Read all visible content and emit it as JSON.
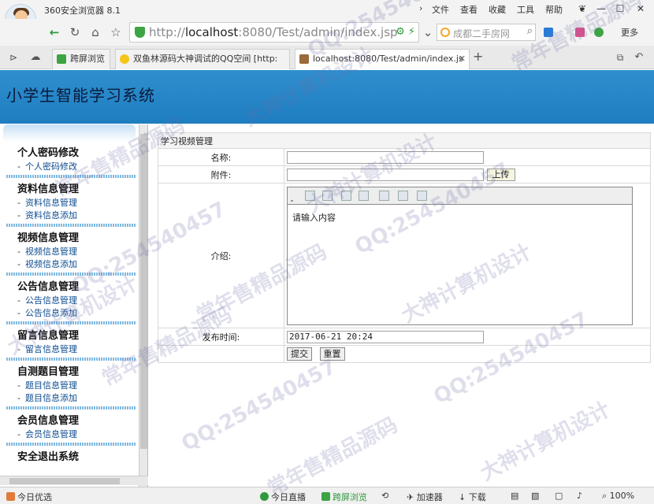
{
  "browser": {
    "app_title": "360安全浏览器 8.1",
    "top_menu": [
      "文件",
      "查看",
      "收藏",
      "工具",
      "帮助"
    ],
    "url_host": "http://",
    "url_main": "localhost",
    "url_rest": ":8080/Test/admin/index.jsp",
    "search_placeholder": "成都二手房网",
    "more_label": "更多",
    "tabs": [
      {
        "label": "跨屏浏览",
        "color": "#3da443"
      },
      {
        "label": "双鱼林源码大神调试的QQ空间 [http:",
        "color": "#f5c518"
      },
      {
        "label": "localhost:8080/Test/admin/index.js",
        "color": "#9a6a3a"
      }
    ]
  },
  "page": {
    "system_title": "小学生智能学习系统"
  },
  "sidebar": {
    "groups": [
      {
        "title": "个人密码修改",
        "items": [
          "个人密码修改"
        ]
      },
      {
        "title": "资料信息管理",
        "items": [
          "资料信息管理",
          "资料信息添加"
        ]
      },
      {
        "title": "视频信息管理",
        "items": [
          "视频信息管理",
          "视频信息添加"
        ]
      },
      {
        "title": "公告信息管理",
        "items": [
          "公告信息管理",
          "公告信息添加"
        ]
      },
      {
        "title": "留言信息管理",
        "items": [
          "留言信息管理"
        ]
      },
      {
        "title": "自测题目管理",
        "items": [
          "题目信息管理",
          "题目信息添加"
        ]
      },
      {
        "title": "会员信息管理",
        "items": [
          "会员信息管理"
        ]
      },
      {
        "title": "安全退出系统",
        "items": []
      }
    ]
  },
  "form": {
    "section_title": "学习视频管理",
    "name_label": "名称:",
    "name_value": "",
    "attachment_label": "附件:",
    "attachment_value": "",
    "upload_button": "上传",
    "intro_label": "介绍:",
    "intro_value": "请输入内容",
    "publish_time_label": "发布时间:",
    "publish_time_value": "2017-06-21 20:24",
    "submit_button": "提交",
    "reset_button": "重置"
  },
  "statusbar": {
    "left": "今日优选",
    "live": "今日直播",
    "cross_screen": "跨屏浏览",
    "accelerator": "加速器",
    "download": "下载",
    "zoom": "100%"
  },
  "watermark": {
    "texts": [
      "QQ:254540457",
      "大神计算机设计",
      "常年售精品源码"
    ]
  }
}
